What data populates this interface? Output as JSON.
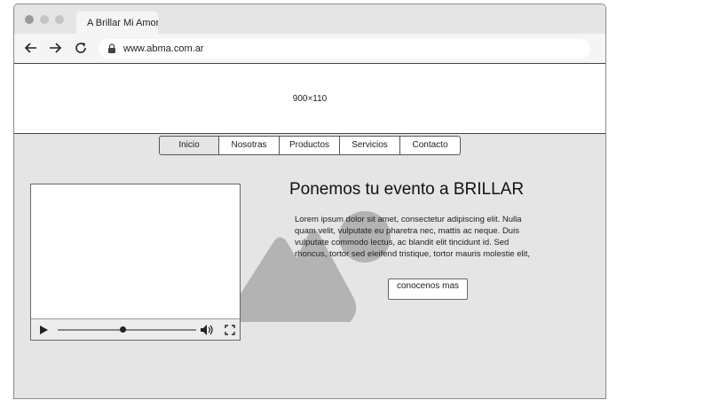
{
  "browser": {
    "tab_title": "A Brillar Mi Amor",
    "url": "www.abma.com.ar",
    "icons": [
      "back-arrow-icon",
      "forward-arrow-icon",
      "reload-icon",
      "lock-icon"
    ],
    "dot_colors": [
      "#9a9a9a",
      "#c4c4c4",
      "#c4c4c4"
    ]
  },
  "banner": {
    "label": "900×110"
  },
  "nav": {
    "items": [
      "Inicio",
      "Nosotras",
      "Productos",
      "Servicios",
      "Contacto"
    ]
  },
  "video": {
    "progress": 0.47,
    "icons": [
      "play-icon",
      "volume-icon",
      "fullscreen-icon"
    ]
  },
  "hero": {
    "heading": "Ponemos tu evento a BRILLAR",
    "body_lines": [
      "Lorem ipsum dolor sit amet, consectetur adipiscing elit. Nulla",
      "quam velit, vulputate eu pharetra nec, mattis ac neque. Duis",
      "vulputate commodo lectus, ac blandit elit tincidunt id. Sed",
      "rhoncus, tortor sed eleifend tristique, tortor mauris molestie elit,"
    ],
    "button_label": "conocenos mas"
  },
  "colors": {
    "page_bg": "#e5e5e5",
    "placeholder_gray": "#b3b3b3"
  }
}
